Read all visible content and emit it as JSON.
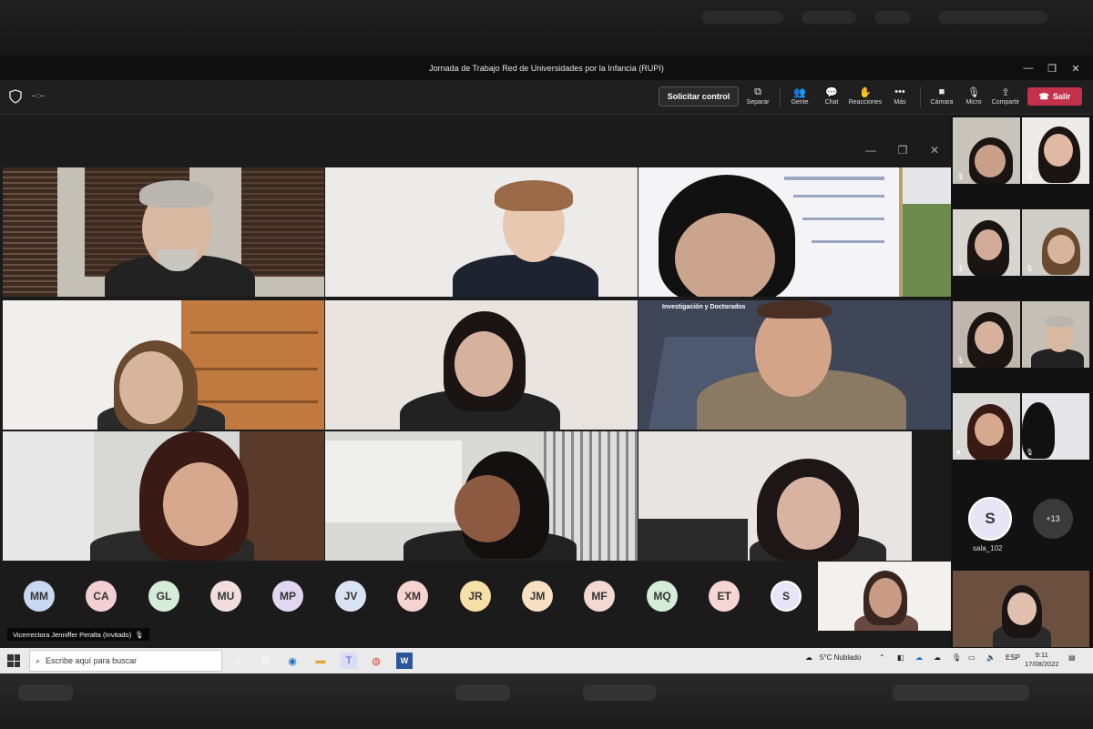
{
  "window": {
    "title": "Jornada de Trabajo Red de Universidades por la Infancia (RUPI)",
    "minimize": "—",
    "maximize": "❐",
    "close": "✕"
  },
  "toolbar": {
    "timer": "--:--",
    "request_control": "Solicitar control",
    "items": [
      {
        "icon": "⧉",
        "label": "Separar"
      },
      {
        "icon": "👥",
        "label": "Gente"
      },
      {
        "icon": "💬",
        "label": "Chat"
      },
      {
        "icon": "✋",
        "label": "Reacciones"
      },
      {
        "icon": "•••",
        "label": "Más"
      },
      {
        "icon": "■",
        "label": "Cámara"
      },
      {
        "icon": "🎙",
        "label": "Micro"
      },
      {
        "icon": "⇪",
        "label": "Compartir"
      }
    ],
    "leave": "Salir"
  },
  "video_grid": {
    "tile_labels": [
      "",
      "",
      "",
      "",
      "",
      "Investigación y Doctorados",
      "",
      "",
      ""
    ]
  },
  "avatars": [
    "MM",
    "CA",
    "GL",
    "MU",
    "MP",
    "JV",
    "XM",
    "JR",
    "JM",
    "MF",
    "MQ",
    "ET",
    "S"
  ],
  "avatar_colors": [
    "#c9d8f0",
    "#f2cfd2",
    "#d5ecd9",
    "#f2dede",
    "#e2d7f1",
    "#d9e3f3",
    "#f6d3cf",
    "#f7e0a8",
    "#f7e0c3",
    "#f1d9d1",
    "#d4ecd9",
    "#f7d5d5",
    "#e7e5f7"
  ],
  "speaker_name": "Vicerrectora Jenniffer Peralta (Invitado)",
  "sidebar": {
    "sala_initial": "S",
    "sala_name": "sala_102",
    "more_count": "+13"
  },
  "taskbar": {
    "search_placeholder": "Escribe aquí para buscar",
    "weather": "5°C  Nublado",
    "lang": "ESP",
    "time": "9:11",
    "date": "17/08/2022"
  }
}
